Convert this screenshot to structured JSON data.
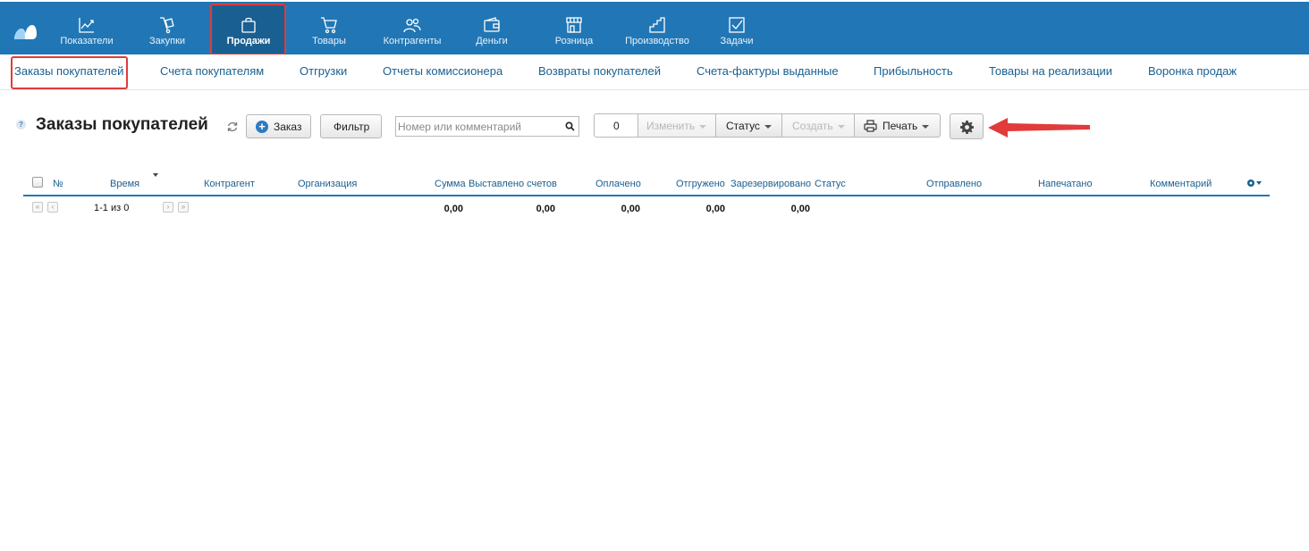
{
  "topnav": {
    "items": [
      {
        "label": "Показатели",
        "icon": "chart-line-icon"
      },
      {
        "label": "Закупки",
        "icon": "handcart-icon"
      },
      {
        "label": "Продажи",
        "icon": "shopping-bag-icon",
        "active": true
      },
      {
        "label": "Товары",
        "icon": "cart-icon"
      },
      {
        "label": "Контрагенты",
        "icon": "people-icon"
      },
      {
        "label": "Деньги",
        "icon": "wallet-icon"
      },
      {
        "label": "Розница",
        "icon": "store-icon"
      },
      {
        "label": "Производство",
        "icon": "factory-icon"
      },
      {
        "label": "Задачи",
        "icon": "checkbox-icon"
      }
    ]
  },
  "subnav": {
    "items": [
      {
        "label": "Заказы покупателей",
        "active": true
      },
      {
        "label": "Счета покупателям"
      },
      {
        "label": "Отгрузки"
      },
      {
        "label": "Отчеты комиссионера"
      },
      {
        "label": "Возвраты покупателей"
      },
      {
        "label": "Счета-фактуры выданные"
      },
      {
        "label": "Прибыльность"
      },
      {
        "label": "Товары на реализации"
      },
      {
        "label": "Воронка продаж"
      }
    ]
  },
  "toolbar": {
    "help": "?",
    "title": "Заказы покупателей",
    "add_label": "Заказ",
    "filter_label": "Фильтр",
    "search_placeholder": "Номер или комментарий",
    "selected_count": "0",
    "edit_label": "Изменить",
    "status_label": "Статус",
    "create_label": "Создать",
    "print_label": "Печать"
  },
  "table": {
    "headers": {
      "num": "№",
      "time": "Время",
      "counterparty": "Контрагент",
      "organization": "Организация",
      "sum": "Сумма",
      "invoiced": "Выставлено счетов",
      "paid": "Оплачено",
      "shipped": "Отгружено",
      "reserved": "Зарезервировано",
      "status": "Статус",
      "sent": "Отправлено",
      "printed": "Напечатано",
      "comment": "Комментарий"
    },
    "pager": {
      "text": "1-1 из 0",
      "first": "«",
      "prev": "‹",
      "next": "›",
      "last": "»"
    },
    "totals": {
      "sum": "0,00",
      "invoiced": "0,00",
      "paid": "0,00",
      "shipped": "0,00",
      "reserved": "0,00"
    }
  },
  "colors": {
    "nav_bg": "#2177b5",
    "nav_active": "#1a5f91",
    "link": "#1a5f91",
    "highlight": "#e23b3b"
  }
}
